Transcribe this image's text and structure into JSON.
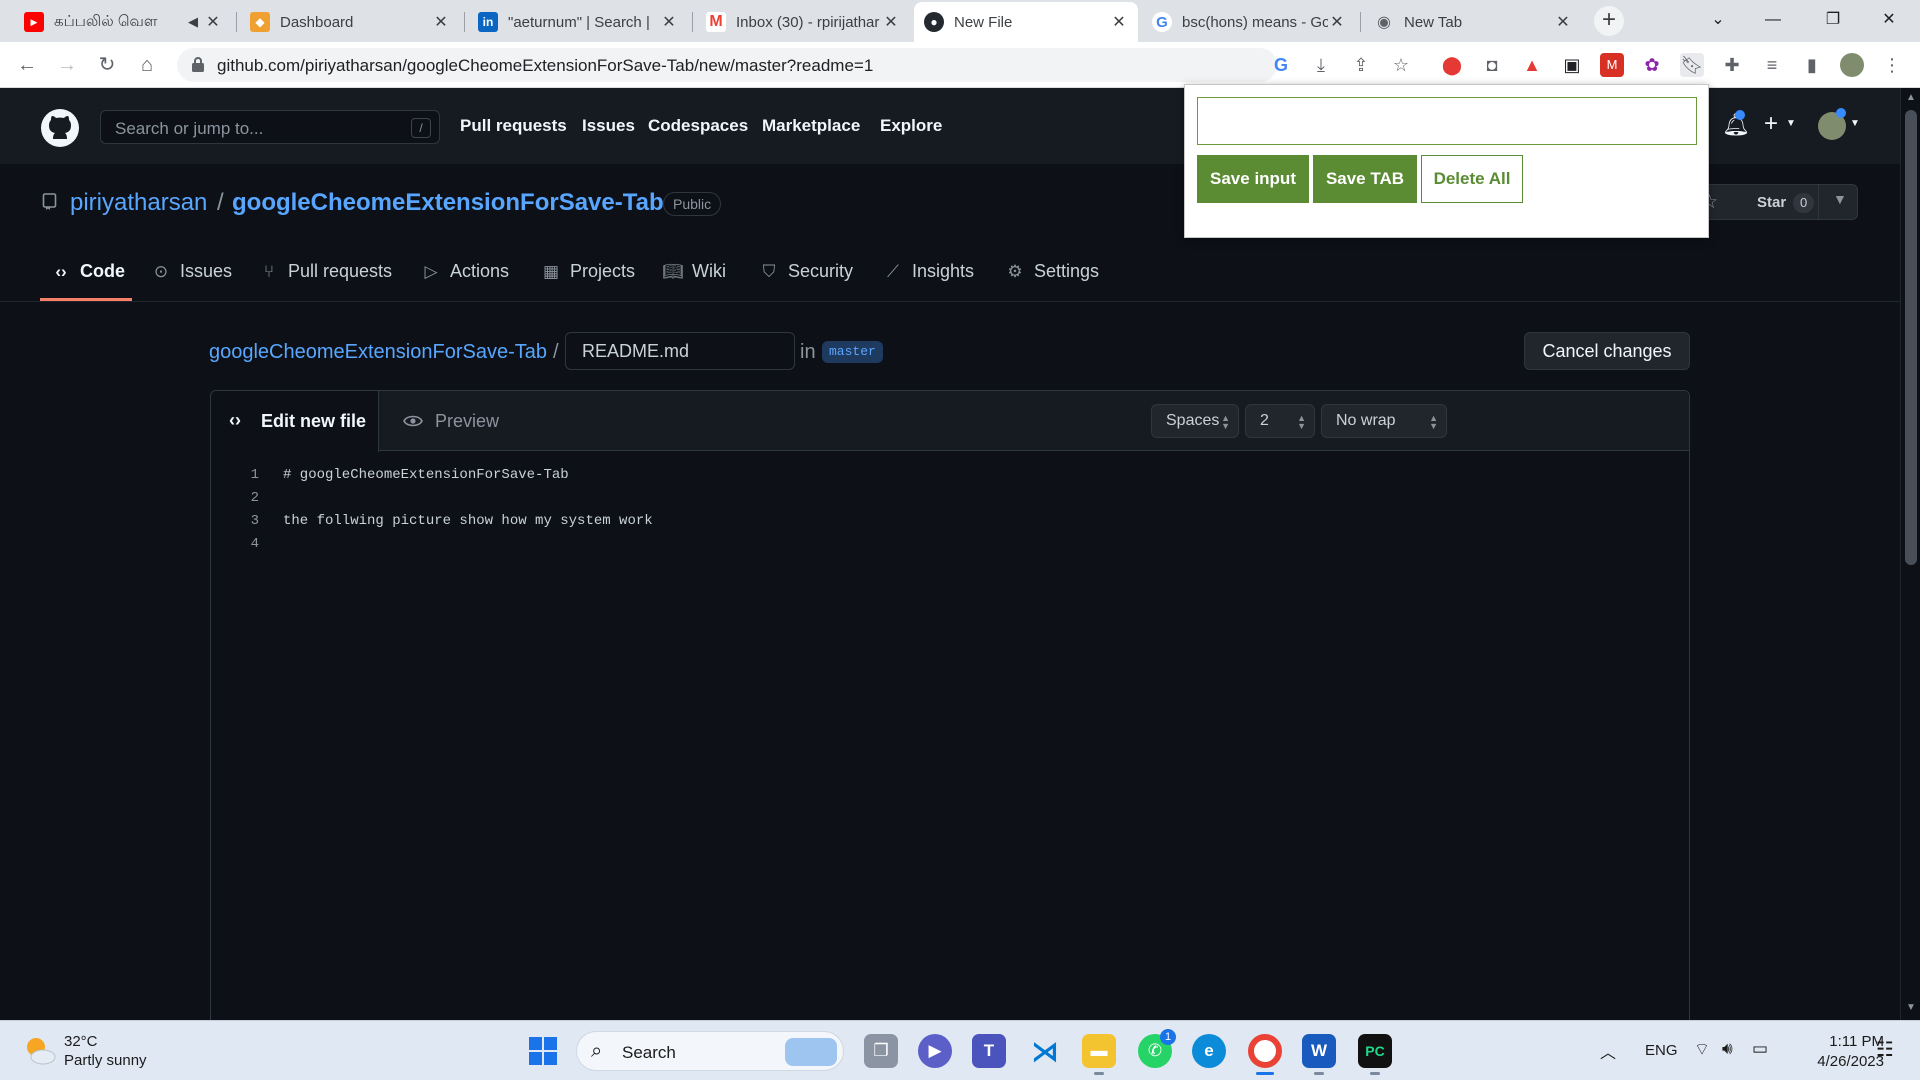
{
  "browser": {
    "tabs": [
      {
        "title": "கப்பலில் வெள",
        "favicon": "youtube-icon",
        "color": "#ff0000"
      },
      {
        "title": "Dashboard",
        "favicon": "dashboard-icon",
        "color": "#f0a030"
      },
      {
        "title": "\"aeturnum\" | Search |",
        "favicon": "linkedin-icon",
        "color": "#0a66c2"
      },
      {
        "title": "Inbox (30) - rpirijathar",
        "favicon": "gmail-icon",
        "color": "#ea4335"
      },
      {
        "title": "New File",
        "favicon": "github-icon",
        "color": "#24292f"
      },
      {
        "title": "bsc(hons) means - Go",
        "favicon": "google-icon",
        "color": "#4285f4"
      },
      {
        "title": "New Tab",
        "favicon": "chrome-icon",
        "color": "#5f6368"
      }
    ],
    "new_tab_label": "+",
    "url": "github.com/piriyatharsan/googleCheomeExtensionForSave-Tab/new/master?readme=1"
  },
  "github": {
    "search_placeholder": "Search or jump to...",
    "search_key": "/",
    "nav": [
      "Pull requests",
      "Issues",
      "Codespaces",
      "Marketplace",
      "Explore"
    ],
    "repo": {
      "owner": "piriyatharsan",
      "sep": "/",
      "name": "googleCheomeExtensionForSave-Tab",
      "visibility": "Public",
      "star_label": "Star",
      "star_count": "0"
    },
    "repo_tabs": [
      "Code",
      "Issues",
      "Pull requests",
      "Actions",
      "Projects",
      "Wiki",
      "Security",
      "Insights",
      "Settings"
    ],
    "editor": {
      "breadcrumb_repo": "googleCheomeExtensionForSave-Tab",
      "breadcrumb_sep": "/",
      "filename": "README.md",
      "in_label": "in",
      "branch": "master",
      "cancel_label": "Cancel changes",
      "tab_edit": "Edit new file",
      "tab_preview": "Preview",
      "indent_mode": "Spaces",
      "indent_size": "2",
      "wrap_mode": "No wrap",
      "lines": [
        {
          "n": "1",
          "text": "# googleCheomeExtensionForSave-Tab"
        },
        {
          "n": "2",
          "text": ""
        },
        {
          "n": "3",
          "text": "the follwing picture show how my system work"
        },
        {
          "n": "4",
          "text": ""
        }
      ]
    }
  },
  "popup": {
    "input_value": "",
    "save_input_label": "Save input",
    "save_tab_label": "Save TAB",
    "delete_label": "Delete All",
    "accent": "#5b8b33"
  },
  "taskbar": {
    "weather_temp": "32°C",
    "weather_desc": "Partly sunny",
    "search_label": "Search",
    "whatsapp_badge": "1",
    "lang": "ENG",
    "time": "1:11 PM",
    "date": "4/26/2023"
  }
}
